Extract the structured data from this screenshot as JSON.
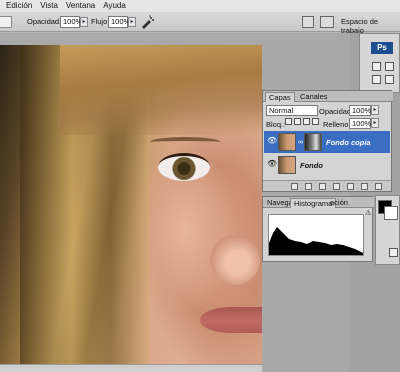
{
  "menu": {
    "items": [
      "Edición",
      "Vista",
      "Ventana",
      "Ayuda"
    ]
  },
  "options_bar": {
    "opacity_label": "Opacidad:",
    "opacity_value": "100%",
    "flow_label": "Flujo:",
    "flow_value": "100%",
    "workspace_label": "Espacio de trabajo"
  },
  "toolbox": {
    "logo": "Ps"
  },
  "layers_panel": {
    "tabs": [
      "Capas",
      "Canales"
    ],
    "blend_mode": "Normal",
    "opacity_label": "Opacidad:",
    "opacity_value": "100%",
    "lock_label": "Bloq.:",
    "fill_label": "Relleno:",
    "fill_value": "100%",
    "layers": [
      {
        "name": "Fondo copia",
        "selected": true
      },
      {
        "name": "Fondo",
        "selected": false
      }
    ]
  },
  "histogram_panel": {
    "tabs": [
      "Navega",
      "Histograma",
      "ación"
    ]
  },
  "icons": [
    "airbrush-icon",
    "eye-icon",
    "chain-link-icon",
    "trash-icon",
    "new-layer-icon",
    "warning-icon"
  ],
  "colors": {
    "selection": "#3a6ec2",
    "panel": "#d4d4d4"
  }
}
